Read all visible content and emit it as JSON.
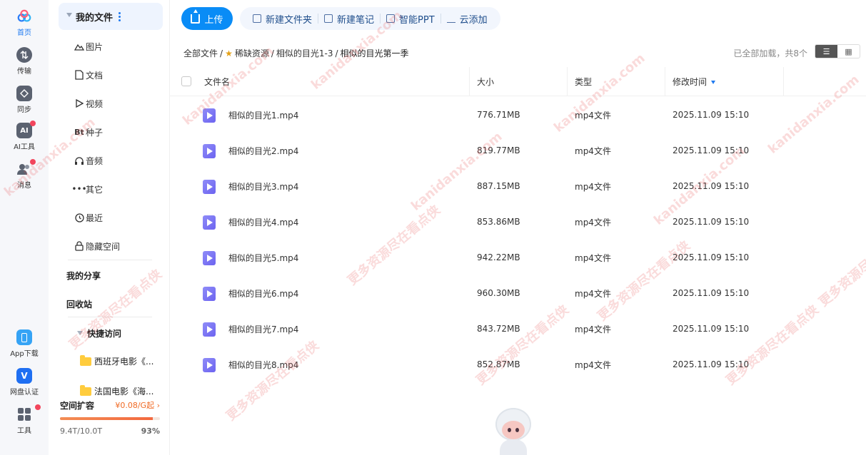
{
  "rail": [
    {
      "label": "首页",
      "icon": "cloud-logo-icon",
      "active": true
    },
    {
      "label": "传输",
      "icon": "transfer-icon"
    },
    {
      "label": "同步",
      "icon": "sync-icon"
    },
    {
      "label": "AI工具",
      "icon": "ai-tools-icon",
      "badge": true
    },
    {
      "label": "消息",
      "icon": "messages-icon",
      "badge": true
    },
    {
      "label": "App下载",
      "icon": "phone-icon"
    },
    {
      "label": "网盘认证",
      "icon": "verify-icon"
    },
    {
      "label": "工具",
      "icon": "apps-grid-icon",
      "badge": true
    }
  ],
  "sidebar": {
    "my_files": "我的文件",
    "categories": [
      {
        "label": "图片",
        "icon": "image-icon"
      },
      {
        "label": "文档",
        "icon": "document-icon"
      },
      {
        "label": "视频",
        "icon": "video-icon"
      },
      {
        "label": "种子",
        "icon": "torrent-icon",
        "glyph": "Bt"
      },
      {
        "label": "音频",
        "icon": "headphones-icon"
      },
      {
        "label": "其它",
        "icon": "more-icon"
      },
      {
        "label": "最近",
        "icon": "clock-icon"
      },
      {
        "label": "隐藏空间",
        "icon": "lock-icon"
      }
    ],
    "my_share": "我的分享",
    "recycle": "回收站",
    "quick_access": "快捷访问",
    "quick_items": [
      "西班牙电影《...",
      "法国电影《海..."
    ],
    "storage": {
      "title": "空间扩容",
      "price": "¥0.08/G起",
      "used": "9.4T/10.0T",
      "percent_label": "93%",
      "percent": 93
    }
  },
  "toolbar": {
    "upload": "上传",
    "tools": [
      {
        "label": "新建文件夹",
        "icon": "new-folder-icon"
      },
      {
        "label": "新建笔记",
        "icon": "new-note-icon"
      },
      {
        "label": "智能PPT",
        "icon": "smart-ppt-icon"
      },
      {
        "label": "云添加",
        "icon": "cloud-add-icon"
      }
    ]
  },
  "breadcrumb": [
    "全部文件",
    "稀缺资源",
    "相似的目光1-3",
    "相似的目光第一季"
  ],
  "loaded_text": "已全部加载，共8个",
  "table": {
    "columns": [
      "文件名",
      "大小",
      "类型",
      "修改时间"
    ],
    "rows": [
      {
        "name": "相似的目光1.mp4",
        "size": "776.71MB",
        "type": "mp4文件",
        "time": "2025.11.09 15:10"
      },
      {
        "name": "相似的目光2.mp4",
        "size": "819.77MB",
        "type": "mp4文件",
        "time": "2025.11.09 15:10"
      },
      {
        "name": "相似的目光3.mp4",
        "size": "887.15MB",
        "type": "mp4文件",
        "time": "2025.11.09 15:10"
      },
      {
        "name": "相似的目光4.mp4",
        "size": "853.86MB",
        "type": "mp4文件",
        "time": "2025.11.09 15:10"
      },
      {
        "name": "相似的目光5.mp4",
        "size": "942.22MB",
        "type": "mp4文件",
        "time": "2025.11.09 15:10"
      },
      {
        "name": "相似的目光6.mp4",
        "size": "960.30MB",
        "type": "mp4文件",
        "time": "2025.11.09 15:10"
      },
      {
        "name": "相似的目光7.mp4",
        "size": "843.72MB",
        "type": "mp4文件",
        "time": "2025.11.09 15:10"
      },
      {
        "name": "相似的目光8.mp4",
        "size": "852.87MB",
        "type": "mp4文件",
        "time": "2025.11.09 15:10"
      }
    ]
  },
  "watermark": [
    "kanidanxia.com",
    "更多资源尽在看点侠"
  ],
  "colors": {
    "accent": "#0a8cf6",
    "badge": "#f2455c",
    "storage": "#f3693f",
    "video": "#7a74f4"
  }
}
